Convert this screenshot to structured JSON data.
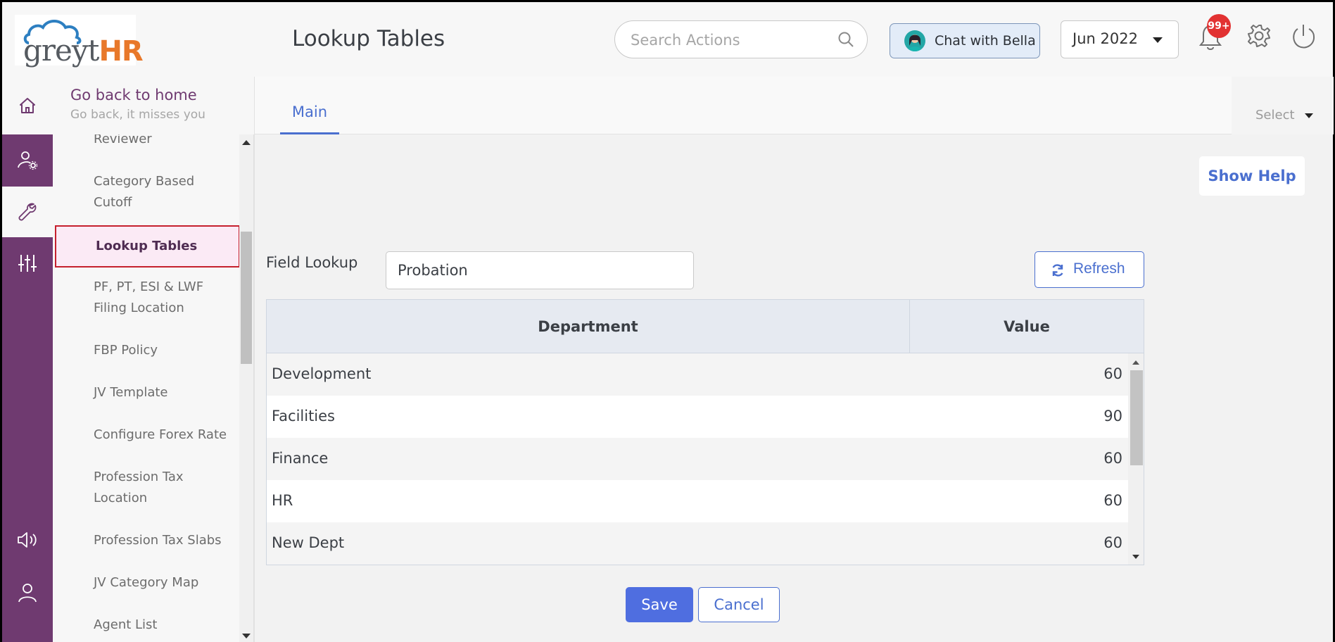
{
  "app": {
    "logo_part1": "greyt",
    "logo_part2": "HR",
    "page_title": "Lookup Tables"
  },
  "header": {
    "search_placeholder": "Search Actions",
    "chat_label": "Chat with Bella",
    "month": "Jun 2022",
    "notification_count": "99+"
  },
  "rail": {
    "icons": [
      "home-icon",
      "user-settings-icon",
      "wrench-icon",
      "sliders-icon",
      "announcement-icon",
      "user-icon"
    ]
  },
  "sidebar": {
    "back_title": "Go back to home",
    "back_subtitle": "Go back, it misses you",
    "items": [
      {
        "label": "Reviewer"
      },
      {
        "label": "Category Based Cutoff"
      },
      {
        "label": "Lookup Tables"
      },
      {
        "label": "PF, PT, ESI & LWF Filing Location"
      },
      {
        "label": "FBP Policy"
      },
      {
        "label": "JV Template"
      },
      {
        "label": "Configure Forex Rate"
      },
      {
        "label": "Profession Tax Location"
      },
      {
        "label": "Profession Tax Slabs"
      },
      {
        "label": "JV Category Map"
      },
      {
        "label": "Agent List"
      }
    ],
    "active_item": "Lookup Tables"
  },
  "main": {
    "tabs": [
      {
        "label": "Main"
      }
    ],
    "select_label": "Select",
    "show_help_label": "Show Help",
    "field_lookup_label": "Field Lookup",
    "field_lookup_value": "Probation",
    "refresh_label": "Refresh",
    "table": {
      "columns": [
        "Department",
        "Value"
      ],
      "rows": [
        {
          "department": "Development",
          "value": "60"
        },
        {
          "department": "Facilities",
          "value": "90"
        },
        {
          "department": "Finance",
          "value": "60"
        },
        {
          "department": "HR",
          "value": "60"
        },
        {
          "department": "New Dept",
          "value": "60"
        }
      ]
    },
    "save_label": "Save",
    "cancel_label": "Cancel"
  },
  "colors": {
    "brand_purple": "#6f3a70",
    "accent_blue": "#4a6fcf",
    "badge_red": "#e23232",
    "logo_orange": "#e8782a",
    "active_border": "#c5202d"
  }
}
